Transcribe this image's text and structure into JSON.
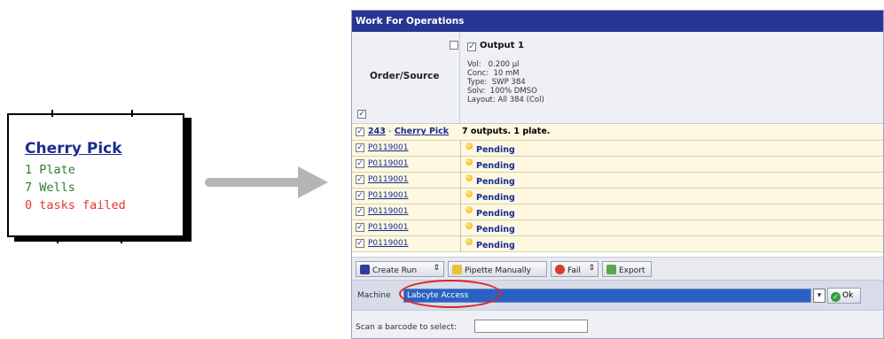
{
  "card": {
    "title": "Cherry Pick",
    "line1": "1 Plate",
    "line2": "7 Wells",
    "line3": "0 tasks failed"
  },
  "window": {
    "title": "Work For Operations"
  },
  "header": {
    "order_source_label": "Order/Source",
    "output_title": "Output 1",
    "details": [
      "Vol:   0.200 µl",
      "Conc:  10 mM",
      "Type:  SWP 384",
      "Solv:  100% DMSO",
      "Layout: All 384 (Col)"
    ]
  },
  "summary": {
    "id": "243",
    "separator": "-",
    "name": "Cherry Pick",
    "info": "7 outputs. 1 plate."
  },
  "rows": [
    {
      "plate": "P0119001",
      "status": "Pending"
    },
    {
      "plate": "P0119001",
      "status": "Pending"
    },
    {
      "plate": "P0119001",
      "status": "Pending"
    },
    {
      "plate": "P0119001",
      "status": "Pending"
    },
    {
      "plate": "P0119001",
      "status": "Pending"
    },
    {
      "plate": "P0119001",
      "status": "Pending"
    },
    {
      "plate": "P0119001",
      "status": "Pending"
    }
  ],
  "toolbar": {
    "create_run": "Create Run",
    "pipette_manually": "Pipette Manually",
    "fail": "Fail",
    "export": "Export"
  },
  "machine": {
    "label": "Machine",
    "selected": "Labcyte Access",
    "ok": "Ok"
  },
  "scan": {
    "label": "Scan a barcode to select:",
    "value": ""
  },
  "colors": {
    "title_bar": "#283593",
    "row_bg": "#fdf8df",
    "link": "#1a2a9a",
    "highlight_ellipse": "#d9262a",
    "card_green": "#2e7d32",
    "card_red": "#e3342f"
  }
}
